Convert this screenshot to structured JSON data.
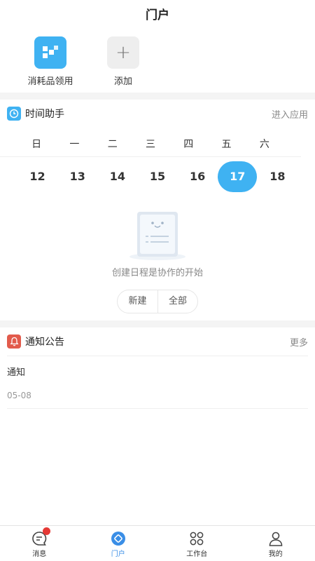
{
  "header": {
    "title": "门户"
  },
  "quick_apps": [
    {
      "label": "消耗品领用",
      "icon": "apps-grid-icon"
    },
    {
      "label": "添加",
      "icon": "plus-icon"
    }
  ],
  "schedule": {
    "title": "时间助手",
    "link": "进入应用",
    "weekdays": [
      "日",
      "一",
      "二",
      "三",
      "四",
      "五",
      "六"
    ],
    "dates": [
      "12",
      "13",
      "14",
      "15",
      "16",
      "17",
      "18"
    ],
    "selected_date": "17",
    "empty_text": "创建日程是协作的开始",
    "new_button": "新建",
    "all_button": "全部"
  },
  "notice": {
    "title": "通知公告",
    "link": "更多",
    "items": [
      {
        "title": "通知",
        "date": "05-08"
      }
    ]
  },
  "tabbar": {
    "items": [
      {
        "label": "消息",
        "icon": "message-icon",
        "has_dot": true
      },
      {
        "label": "门户",
        "icon": "portal-icon",
        "active": true
      },
      {
        "label": "工作台",
        "icon": "workbench-icon"
      },
      {
        "label": "我的",
        "icon": "profile-icon"
      }
    ]
  },
  "colors": {
    "accent": "#3fb2f2",
    "tab_active": "#3a8ee6",
    "notice_icon": "#e25b4c",
    "dot": "#e53935"
  }
}
